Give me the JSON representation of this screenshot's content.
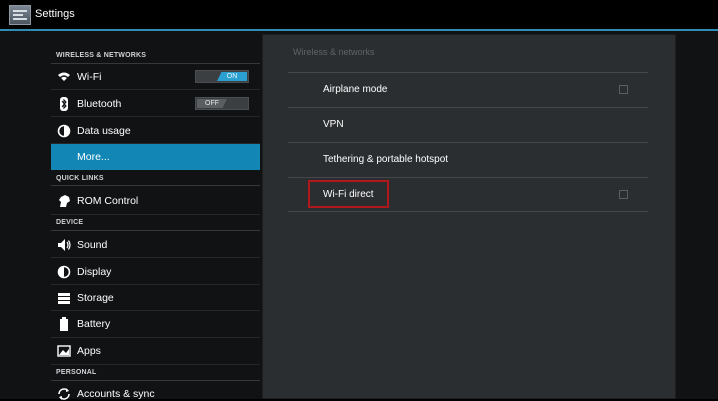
{
  "actionbar": {
    "title": "Settings",
    "accent": "#2e8cb6"
  },
  "sections": {
    "wireless": "WIRELESS & NETWORKS",
    "quick_links": "QUICK LINKS",
    "device": "DEVICE",
    "personal": "PERSONAL"
  },
  "left_items": {
    "wifi": {
      "label": "Wi-Fi",
      "icon": "wifi-icon",
      "toggle": "ON"
    },
    "bluetooth": {
      "label": "Bluetooth",
      "icon": "bluetooth-icon",
      "toggle": "OFF"
    },
    "data_usage": {
      "label": "Data usage",
      "icon": "data-usage-icon"
    },
    "more": {
      "label": "More...",
      "selected": true
    },
    "rom_control": {
      "label": "ROM Control",
      "icon": "rom-control-icon"
    },
    "sound": {
      "label": "Sound",
      "icon": "sound-icon"
    },
    "display": {
      "label": "Display",
      "icon": "display-icon"
    },
    "storage": {
      "label": "Storage",
      "icon": "storage-icon"
    },
    "battery": {
      "label": "Battery",
      "icon": "battery-icon"
    },
    "apps": {
      "label": "Apps",
      "icon": "apps-icon"
    },
    "accounts": {
      "label": "Accounts & sync",
      "icon": "sync-icon"
    }
  },
  "right_panel": {
    "header": "Wireless & networks",
    "items": {
      "airplane": {
        "label": "Airplane mode",
        "checked": false
      },
      "vpn": {
        "label": "VPN"
      },
      "tethering": {
        "label": "Tethering & portable hotspot"
      },
      "wifi_direct": {
        "label": "Wi-Fi direct",
        "checked": false
      }
    }
  },
  "colors": {
    "selected": "#1287b6",
    "toggle_on": "#2b9fd0",
    "highlight_box": "#b0181c"
  }
}
